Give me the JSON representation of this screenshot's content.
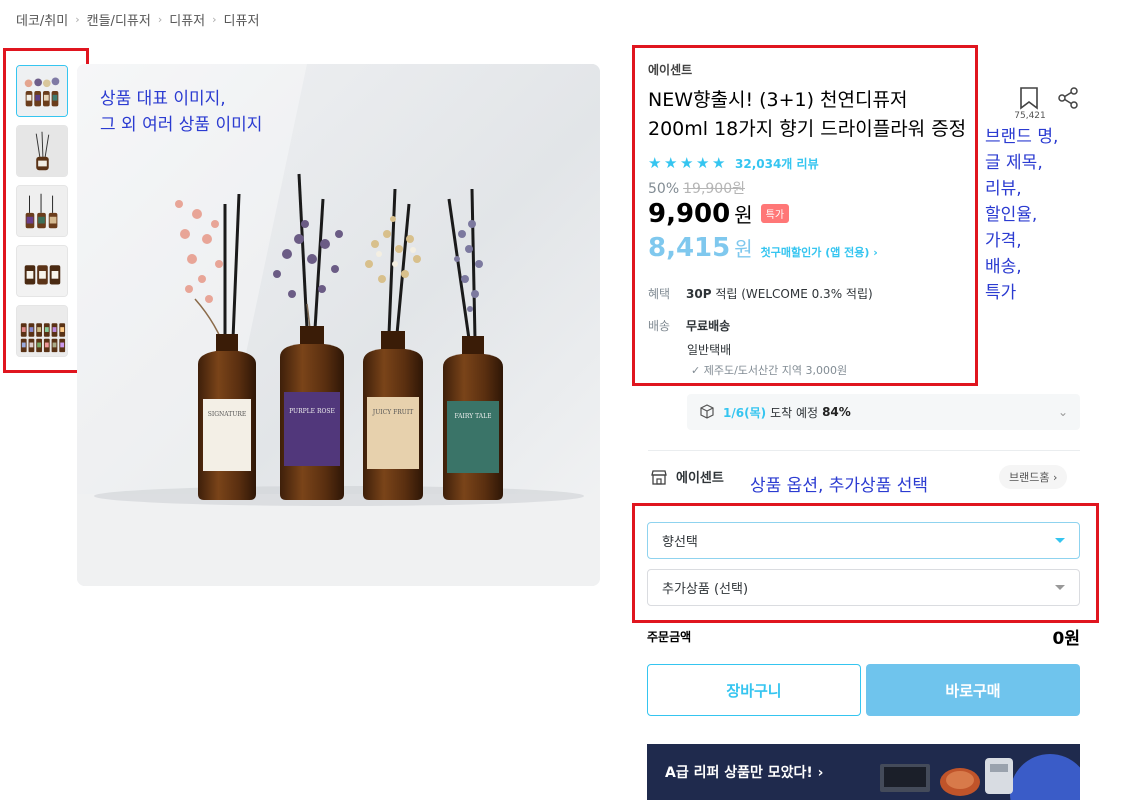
{
  "breadcrumb": [
    "데코/취미",
    "캔들/디퓨저",
    "디퓨저",
    "디퓨저"
  ],
  "annotations": {
    "images": [
      "상품 대표 이미지,",
      "그 외 여러 상품 이미지"
    ],
    "info": [
      "브랜드 명,",
      "글 제목,",
      "리뷰,",
      "할인율,",
      "가격,",
      "배송,",
      "특가"
    ],
    "options": "상품 옵션, 추가상품 선택"
  },
  "product": {
    "brand": "에이센트",
    "title": "NEW향출시! (3+1) 천연디퓨저 200ml 18가지 향기 드라이플라워 증정",
    "rating_stars": 5,
    "reviews": "32,034개 리뷰",
    "discount_rate": "50%",
    "original_price": "19,900원",
    "price": "9,900",
    "price_unit": "원",
    "badge": "특가",
    "coupon_price": "8,415",
    "coupon_unit": "원",
    "coupon_desc": "첫구매할인가 (앱 전용) ›",
    "bookmark_count": "75,421"
  },
  "benefits": {
    "label": "혜택",
    "points": "30P",
    "points_desc": "적립 (WELCOME 0.3% 적립)"
  },
  "shipping": {
    "label": "배송",
    "type": "무료배송",
    "method": "일반택배",
    "extra": "✓ 제주도/도서산간 지역 3,000원"
  },
  "delivery": {
    "date": "1/6(목)",
    "text": "도착 예정",
    "percent": "84%"
  },
  "store": {
    "name": "에이센트",
    "brand_home": "브랜드홈 ›"
  },
  "options": {
    "scent": "향선택",
    "addon": "추가상품 (선택)"
  },
  "order": {
    "label": "주문금액",
    "amount": "0원"
  },
  "buttons": {
    "cart": "장바구니",
    "buy": "바로구매"
  },
  "banner": {
    "text": "A급 리퍼 상품만 모았다! ›"
  },
  "image_labels": [
    "SIGNATURE",
    "PURPLE ROSE",
    "JUICY FRUIT",
    "FAIRY TALE"
  ],
  "colors": {
    "accent": "#35c5f0",
    "annotation": "#2b3bd1",
    "highlight_box": "#e0151f"
  }
}
